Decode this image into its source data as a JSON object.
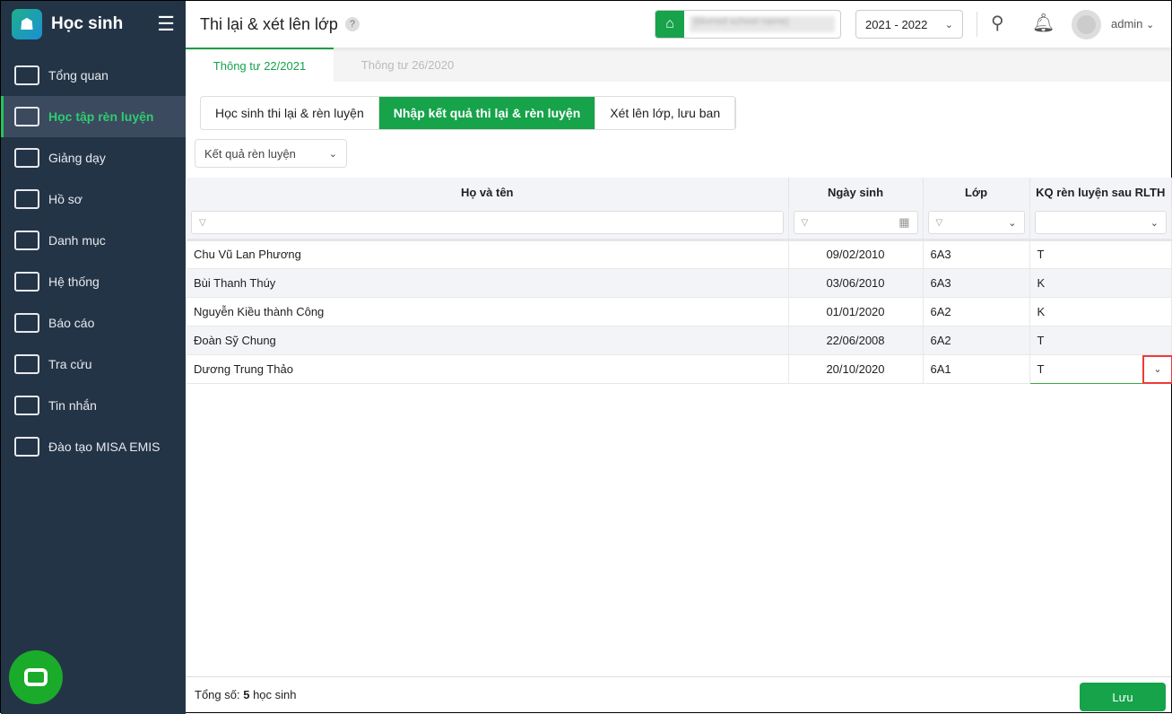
{
  "app": {
    "title": "Học sinh"
  },
  "sidebar": {
    "items": [
      {
        "label": "Tổng quan",
        "icon": "bar-chart-icon"
      },
      {
        "label": "Học tập rèn luyện",
        "icon": "book-icon",
        "active": true
      },
      {
        "label": "Giảng dạy",
        "icon": "board-icon"
      },
      {
        "label": "Hồ sơ",
        "icon": "document-icon"
      },
      {
        "label": "Danh mục",
        "icon": "folder-icon"
      },
      {
        "label": "Hệ thống",
        "icon": "gear-icon"
      },
      {
        "label": "Báo cáo",
        "icon": "pie-chart-icon"
      },
      {
        "label": "Tra cứu",
        "icon": "search-icon"
      },
      {
        "label": "Tin nhắn",
        "icon": "bell-icon"
      },
      {
        "label": "Đào tạo MISA EMIS",
        "icon": "box-icon"
      }
    ]
  },
  "header": {
    "title": "Thi lại & xét lên lớp",
    "help": "?",
    "school": "(blurred school name)",
    "year": "2021 - 2022",
    "user": "admin"
  },
  "tabs": [
    "Thông tư 22/2021",
    "Thông tư 26/2020"
  ],
  "segments": [
    "Học sinh thi lại & rèn luyện",
    "Nhập kết quả thi lại & rèn luyện",
    "Xét lên lớp, lưu ban"
  ],
  "filter_select": "Kết quả rèn luyện",
  "table": {
    "columns": [
      "Họ và tên",
      "Ngày sinh",
      "Lớp",
      "KQ rèn luyện sau RLTH"
    ],
    "rows": [
      [
        "Chu Vũ Lan Phương",
        "09/02/2010",
        "6A3",
        "T"
      ],
      [
        "Bùi Thanh Thúy",
        "03/06/2010",
        "6A3",
        "K"
      ],
      [
        "Nguyễn Kiều thành Công",
        "01/01/2020",
        "6A2",
        "K"
      ],
      [
        "Đoàn Sỹ Chung",
        "22/06/2008",
        "6A2",
        "T"
      ],
      [
        "Dương Trung Thảo",
        "20/10/2020",
        "6A1",
        "T"
      ]
    ]
  },
  "footer": {
    "total_label": "Tổng số:",
    "total": "5",
    "unit": "học sinh",
    "save": "Lưu"
  }
}
